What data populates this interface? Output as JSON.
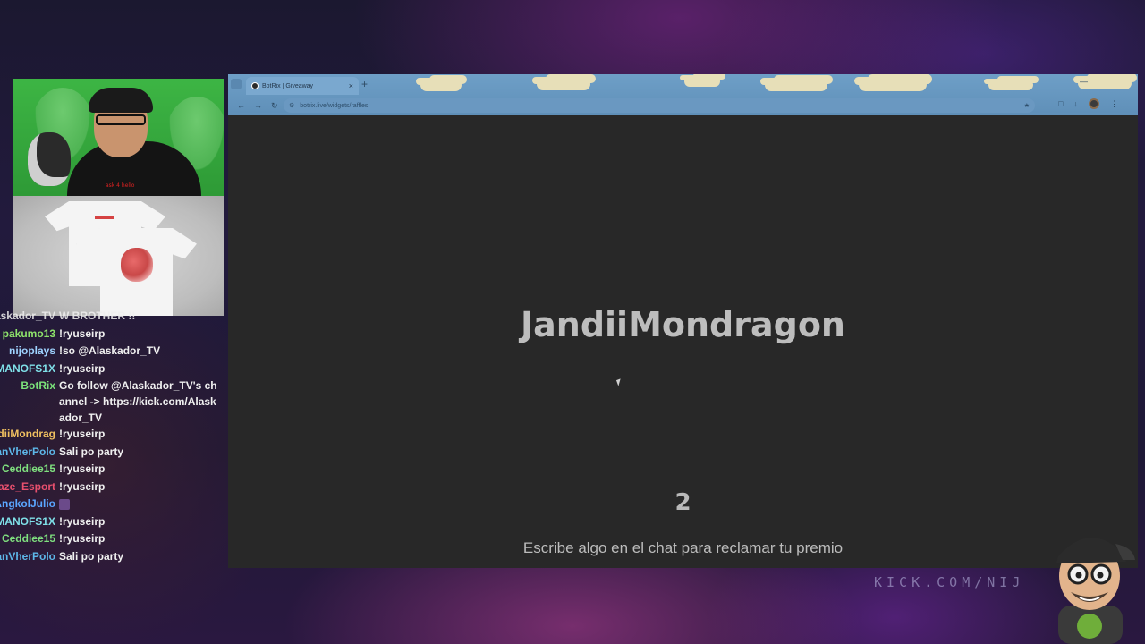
{
  "stream": {
    "merch_shirt_text": "ask 4 hello",
    "watermark": "KICK.COM/NIJ"
  },
  "chat": {
    "messages": [
      {
        "user": "Alaskador_TV",
        "text": "W BROTHER !!"
      },
      {
        "user": "pakumo13",
        "text": "!ryuseirp",
        "color": "#8ee26b"
      },
      {
        "user": "nijoplays",
        "text": "!so @Alaskador_TV",
        "color": "#9fd3ff"
      },
      {
        "user": "MANOFS1X",
        "text": "!ryuseirp",
        "color": "#7fe0e8"
      },
      {
        "user": "BotRix",
        "text": "Go follow @Alaskador_TV's channel -> https://kick.com/Alaskador_TV",
        "color": "#7be37b"
      },
      {
        "user": "JandiiMondrag...",
        "text": "!ryuseirp",
        "color": "#f0c060"
      },
      {
        "user": "JanVherPolo",
        "text": "Sali po party",
        "color": "#5db7e8"
      },
      {
        "user": "Ceddiee15",
        "text": "!ryuseirp",
        "color": "#7fe07f"
      },
      {
        "user": "Blaze_Esport",
        "text": "!ryuseirp",
        "color": "#e8506e"
      },
      {
        "user": "AngkolJulio",
        "text": "",
        "color": "#5aa6ff",
        "emote": true
      },
      {
        "user": "MANOFS1X",
        "text": "!ryuseirp",
        "color": "#7fe0e8"
      },
      {
        "user": "Ceddiee15",
        "text": "!ryuseirp",
        "color": "#7fe07f"
      },
      {
        "user": "JanVherPolo",
        "text": "Sali po party",
        "color": "#5db7e8"
      }
    ]
  },
  "browser": {
    "tab_title": "BotRix | Giveaway",
    "url": "botrix.live/widgets/raffles",
    "nav": {
      "back": "←",
      "forward": "→",
      "reload": "↻"
    },
    "tab_close": "×",
    "new_tab": "+",
    "window_minimize": "—"
  },
  "raffle": {
    "winner": "JandiiMondragon",
    "countdown": "2",
    "instructions": "Escribe algo en el chat para reclamar tu premio"
  },
  "colors": {
    "page_bg": "#282828",
    "winner_text": "#bdbdbd",
    "browser_chrome": "#6e9fc7"
  }
}
